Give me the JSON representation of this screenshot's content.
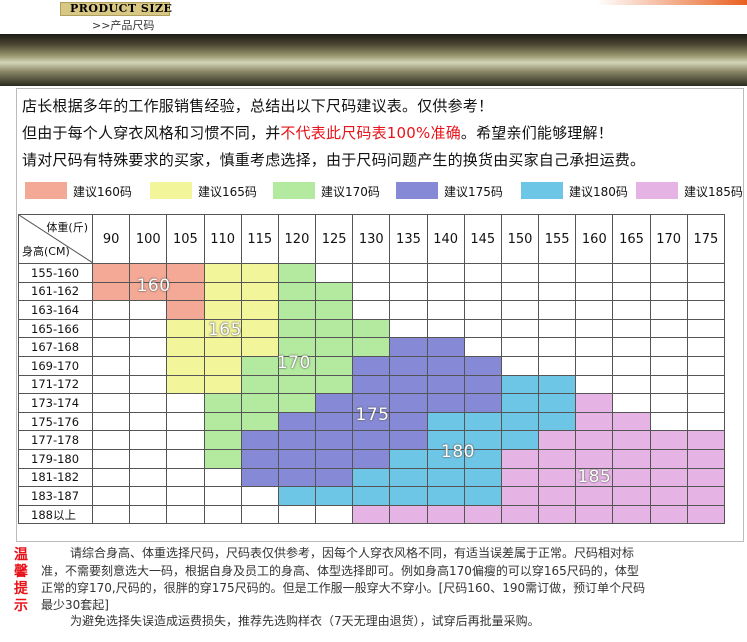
{
  "header": {
    "title_en": "PRODUCT SIZE",
    "title_cn": ">>产品尺码"
  },
  "intro": {
    "line1": "店长根据多年的工作服销售经验，总结出以下尺码建议表。仅供参考！",
    "line2_prefix": "但由于每个人穿衣风格和习惯不同，并",
    "line2_highlight": "不代表此尺码表100%准确",
    "line2_suffix": "。希望亲们能够理解！",
    "line3": "请对尺码有特殊要求的买家，慎重考虑选择，由于尺码问题产生的换货由买家自己承担运费。"
  },
  "legend": [
    {
      "label": "建议160码",
      "color": "#f4a996"
    },
    {
      "label": "建议165码",
      "color": "#f2f59a"
    },
    {
      "label": "建议170码",
      "color": "#b4e9a0"
    },
    {
      "label": "建议175码",
      "color": "#8689d5"
    },
    {
      "label": "建议180码",
      "color": "#6ec6e6"
    },
    {
      "label": "建议185码",
      "color": "#e6b4e4"
    }
  ],
  "table": {
    "corner_weight": "体重(斤)",
    "corner_height": "身高(CM)",
    "weights": [
      "90",
      "100",
      "105",
      "110",
      "115",
      "120",
      "125",
      "130",
      "135",
      "140",
      "145",
      "150",
      "155",
      "160",
      "165",
      "170",
      "175"
    ],
    "rows": [
      {
        "height": "155-160",
        "cells": [
          "160",
          "160",
          "160",
          "165",
          "165",
          "170",
          "",
          "",
          "",
          "",
          "",
          "",
          "",
          "",
          "",
          "",
          ""
        ]
      },
      {
        "height": "161-162",
        "cells": [
          "160",
          "160",
          "160",
          "165",
          "165",
          "170",
          "170",
          "",
          "",
          "",
          "",
          "",
          "",
          "",
          "",
          "",
          ""
        ]
      },
      {
        "height": "163-164",
        "cells": [
          "",
          "",
          "160",
          "165",
          "165",
          "170",
          "170",
          "",
          "",
          "",
          "",
          "",
          "",
          "",
          "",
          "",
          ""
        ]
      },
      {
        "height": "165-166",
        "cells": [
          "",
          "",
          "165",
          "165",
          "165",
          "170",
          "170",
          "170",
          "",
          "",
          "",
          "",
          "",
          "",
          "",
          "",
          ""
        ]
      },
      {
        "height": "167-168",
        "cells": [
          "",
          "",
          "165",
          "165",
          "165",
          "170",
          "170",
          "170",
          "175",
          "175",
          "",
          "",
          "",
          "",
          "",
          "",
          ""
        ]
      },
      {
        "height": "169-170",
        "cells": [
          "",
          "",
          "165",
          "165",
          "170",
          "170",
          "170",
          "175",
          "175",
          "175",
          "175",
          "",
          "",
          "",
          "",
          "",
          ""
        ]
      },
      {
        "height": "171-172",
        "cells": [
          "",
          "",
          "165",
          "165",
          "170",
          "170",
          "170",
          "175",
          "175",
          "175",
          "175",
          "180",
          "180",
          "",
          "",
          "",
          ""
        ]
      },
      {
        "height": "173-174",
        "cells": [
          "",
          "",
          "",
          "170",
          "170",
          "170",
          "175",
          "175",
          "175",
          "175",
          "175",
          "180",
          "180",
          "185",
          "",
          "",
          ""
        ]
      },
      {
        "height": "175-176",
        "cells": [
          "",
          "",
          "",
          "170",
          "170",
          "175",
          "175",
          "175",
          "175",
          "180",
          "180",
          "180",
          "180",
          "185",
          "185",
          "",
          ""
        ]
      },
      {
        "height": "177-178",
        "cells": [
          "",
          "",
          "",
          "170",
          "175",
          "175",
          "175",
          "175",
          "175",
          "180",
          "180",
          "180",
          "185",
          "185",
          "185",
          "185",
          "185"
        ]
      },
      {
        "height": "179-180",
        "cells": [
          "",
          "",
          "",
          "170",
          "175",
          "175",
          "175",
          "175",
          "180",
          "180",
          "180",
          "185",
          "185",
          "185",
          "185",
          "185",
          "185"
        ]
      },
      {
        "height": "181-182",
        "cells": [
          "",
          "",
          "",
          "",
          "175",
          "175",
          "175",
          "180",
          "180",
          "180",
          "180",
          "185",
          "185",
          "185",
          "185",
          "185",
          "185"
        ]
      },
      {
        "height": "183-187",
        "cells": [
          "",
          "",
          "",
          "",
          "",
          "180",
          "180",
          "180",
          "180",
          "180",
          "180",
          "185",
          "185",
          "185",
          "185",
          "185",
          "185"
        ]
      },
      {
        "height": "188以上",
        "cells": [
          "",
          "",
          "",
          "",
          "",
          "",
          "",
          "185",
          "185",
          "185",
          "185",
          "185",
          "185",
          "185",
          "185",
          "185",
          "185"
        ]
      }
    ],
    "zone_labels": [
      {
        "text": "160",
        "color_key": "160"
      },
      {
        "text": "165",
        "color_key": "165"
      },
      {
        "text": "170",
        "color_key": "170"
      },
      {
        "text": "175",
        "color_key": "175"
      },
      {
        "text": "180",
        "color_key": "180"
      },
      {
        "text": "185",
        "color_key": "185"
      }
    ]
  },
  "tips": {
    "title": "温馨提示",
    "line1": "请综合身高、体重选择尺码，尺码表仅供参考，因每个人穿衣风格不同，有适当误差属于正常。尺码相对标",
    "line2": "准，不需要刻意选大一码，根据自身及员工的身高、体型选择即可。例如身高170偏瘦的可以穿165尺码的，体型",
    "line3": "正常的穿170,尺码的，很胖的穿175尺码的。但是工作服一般穿大不穿小。[尺码160、190需订做，预订单个尺码",
    "line4": "最少30套起]",
    "line5": "为避免选择失误造成运费损失，推荐先选购样衣（7天无理由退货），试穿后再批量采购。"
  }
}
